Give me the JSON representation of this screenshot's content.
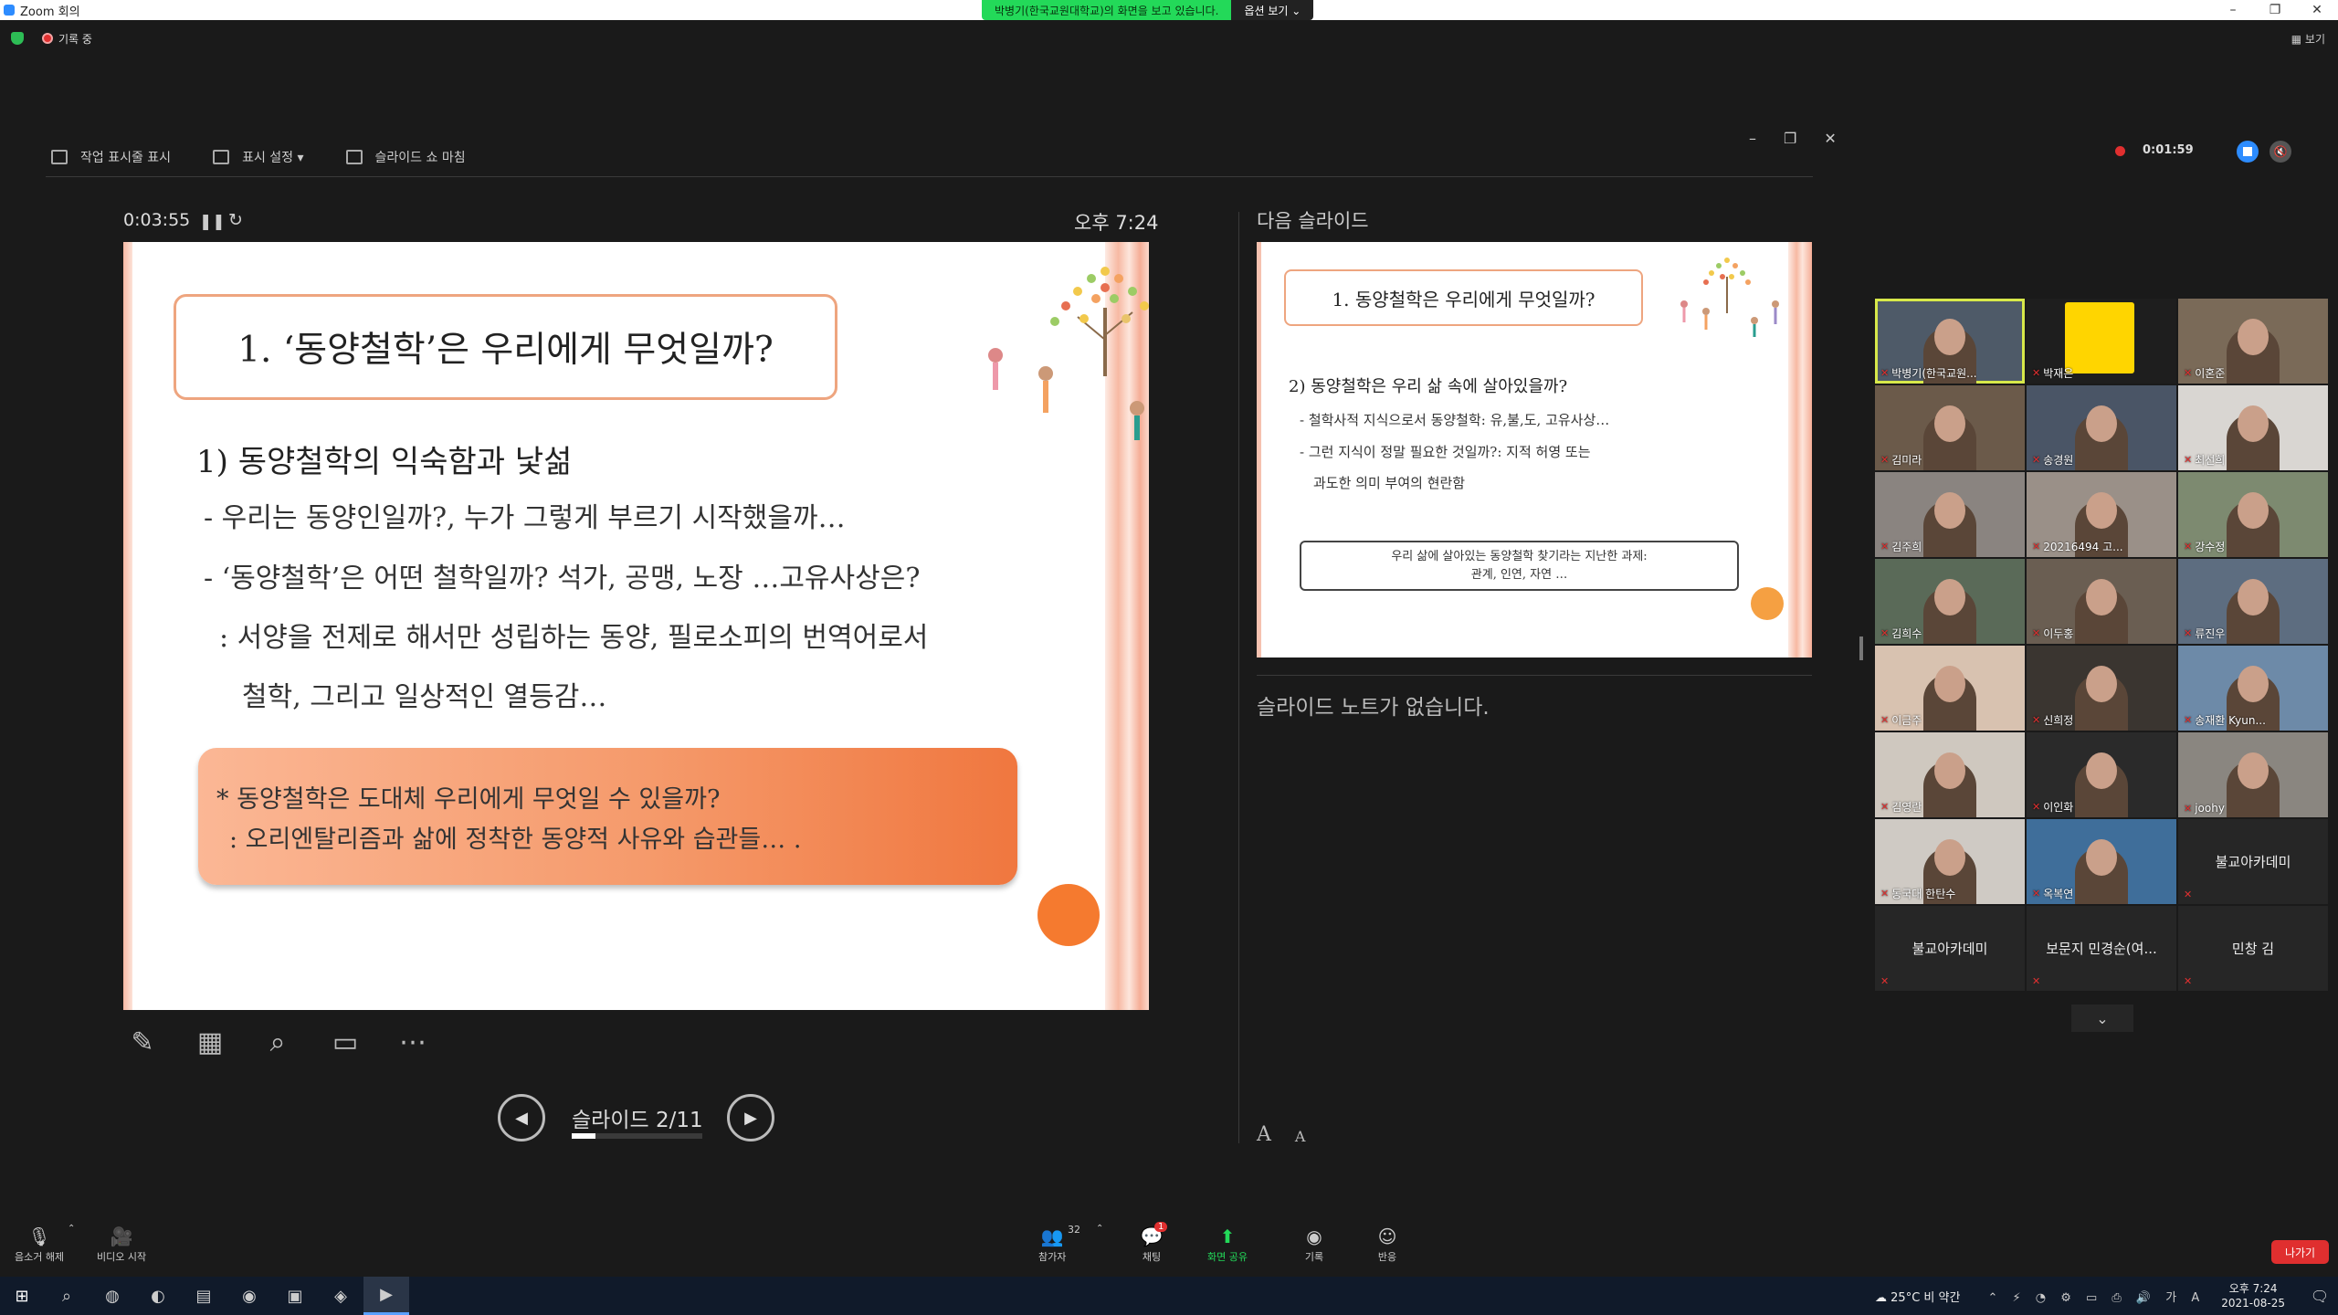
{
  "window": {
    "title": "Zoom 회의",
    "share_banner": "박병기(한국교원대학교)의 화면을 보고 있습니다.",
    "view_options": "옵션 보기 ⌄",
    "controls": [
      "–",
      "❐",
      "✕"
    ]
  },
  "status": {
    "recording_label": "기록 중",
    "view_label": "▦ 보기"
  },
  "presenter": {
    "toolbar": {
      "taskbar_label": "작업 표시줄 표시",
      "display_settings_label": "표시 설정 ▾",
      "end_show_label": "슬라이드 쇼 마침"
    },
    "window_controls": [
      "–",
      "❐",
      "✕"
    ],
    "elapsed_time": "0:03:55",
    "clock": "오후 7:24",
    "next_slide_label": "다음 슬라이드",
    "notes_text": "슬라이드 노트가 없습니다.",
    "slide_counter": "슬라이드 2/11",
    "progress": 0.18,
    "font_bigger": "A",
    "font_smaller": "A"
  },
  "current_slide": {
    "title": "1. ‘동양철학’은 우리에게 무엇일까?",
    "subtitle": "1) 동양철학의 익숙함과 낯섦",
    "lines": [
      "- 우리는 동양인일까?, 누가 그렇게 부르기 시작했을까…",
      "- ‘동양철학’은 어떤 철학일까? 석가, 공맹, 노장 …고유사상은?",
      ": 서양을 전제로 해서만 성립하는 동양, 필로소피의 번역어로서",
      "철학, 그리고 일상적인 열등감…"
    ],
    "callout_1": "* 동양철학은 도대체 우리에게 무엇일 수 있을까?",
    "callout_2": ": 오리엔탈리즘과 삶에 정착한 동양적 사유와 습관들… ."
  },
  "next_slide": {
    "title": "1. 동양철학은 우리에게 무엇일까?",
    "subtitle": "2) 동양철학은 우리 삶 속에 살아있을까?",
    "lines": [
      "- 철학사적 지식으로서 동양철학: 유,불,도, 고유사상…",
      "- 그런 지식이 정말 필요한 것일까?: 지적 허영 또는",
      "과도한 의미 부여의 현란함"
    ],
    "box_line_1": "우리 삶에 살아있는 동양철학 찾기라는 지난한 과제:",
    "box_line_2": "관계, 인연, 자연 …"
  },
  "recording": {
    "time": "0:01:59"
  },
  "participants": [
    {
      "name": "박병기(한국교원...",
      "type": "video",
      "active": true,
      "bg": "#4e5a68"
    },
    {
      "name": "박재은",
      "type": "video",
      "bg": "#1e1e1e",
      "yellow": true
    },
    {
      "name": "이혼준",
      "type": "video",
      "bg": "#7a6a58"
    },
    {
      "name": "김미라",
      "type": "video",
      "bg": "#6b5a4a"
    },
    {
      "name": "송경원",
      "type": "video",
      "bg": "#4a5566"
    },
    {
      "name": "최선희",
      "type": "video",
      "bg": "#d9d6d2"
    },
    {
      "name": "김주희",
      "type": "video",
      "bg": "#8a8480"
    },
    {
      "name": "20216494 고...",
      "type": "video",
      "bg": "#9a9088"
    },
    {
      "name": "강수정",
      "type": "video",
      "bg": "#7d8a70"
    },
    {
      "name": "김희수",
      "type": "video",
      "bg": "#5a6a58"
    },
    {
      "name": "이두홍",
      "type": "video",
      "bg": "#6a5e52"
    },
    {
      "name": "류진우",
      "type": "video",
      "bg": "#5d6d80"
    },
    {
      "name": "이금주",
      "type": "video",
      "bg": "#d8c2b0"
    },
    {
      "name": "신희정",
      "type": "video",
      "bg": "#3a3530"
    },
    {
      "name": "송재환 Kyun...",
      "type": "video",
      "bg": "#6d8aa8"
    },
    {
      "name": "김영란",
      "type": "video",
      "bg": "#cfc8bf"
    },
    {
      "name": "이인화",
      "type": "video",
      "bg": "#2a2a2a"
    },
    {
      "name": "joohy",
      "type": "video",
      "bg": "#8a8680"
    },
    {
      "name": "동국대 한탄수",
      "type": "video",
      "bg": "#cfcac4"
    },
    {
      "name": "옥복연",
      "type": "video",
      "bg": "#3f6e9a"
    },
    {
      "name": "불교아카데미",
      "type": "name"
    },
    {
      "name": "불교아카데미",
      "type": "name"
    },
    {
      "name": "보문지 민경순(여...",
      "type": "name"
    },
    {
      "name": "민창 김",
      "type": "name"
    }
  ],
  "bottom_toolbar": {
    "mute": "음소거 해제",
    "video": "비디오 시작",
    "participants": "참가자",
    "participants_count": "32",
    "chat": "채팅",
    "chat_badge": "1",
    "share": "화면 공유",
    "record": "기록",
    "reactions": "반응",
    "leave": "나가기"
  },
  "taskbar": {
    "weather": "☁ 25°C 비 약간",
    "time": "오후 7:24",
    "date": "2021-08-25"
  },
  "colors": {
    "accent": "#2d8cff",
    "share_green": "#23d959",
    "leave_red": "#e02f2f",
    "slide_orange": "#f57a2f"
  }
}
